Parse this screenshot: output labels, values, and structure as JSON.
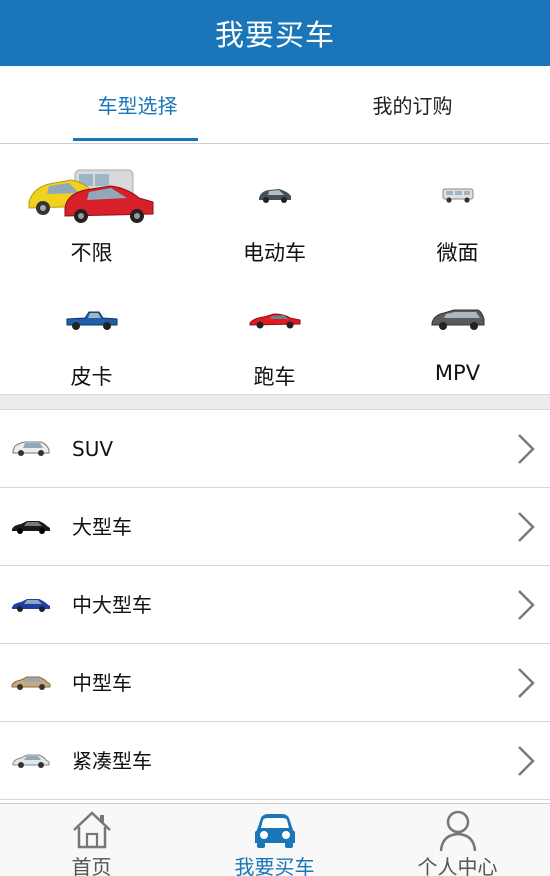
{
  "header": {
    "title": "我要买车"
  },
  "tabs": [
    {
      "label": "车型选择",
      "active": true
    },
    {
      "label": "我的订购",
      "active": false
    }
  ],
  "categories": [
    {
      "label": "不限",
      "icon": "car-group-icon"
    },
    {
      "label": "电动车",
      "icon": "electric-car-icon"
    },
    {
      "label": "微面",
      "icon": "minivan-icon"
    },
    {
      "label": "皮卡",
      "icon": "pickup-icon"
    },
    {
      "label": "跑车",
      "icon": "sports-car-icon"
    },
    {
      "label": "MPV",
      "icon": "mpv-icon"
    }
  ],
  "list": [
    {
      "label": "SUV",
      "icon": "suv-icon",
      "color": "#e8e8e8"
    },
    {
      "label": "大型车",
      "icon": "large-car-icon",
      "color": "#1a1a1a"
    },
    {
      "label": "中大型车",
      "icon": "mid-large-car-icon",
      "color": "#1f3fa8"
    },
    {
      "label": "中型车",
      "icon": "mid-car-icon",
      "color": "#c9a77a"
    },
    {
      "label": "紧凑型车",
      "icon": "compact-car-icon",
      "color": "#e6e6e6"
    }
  ],
  "bottom_nav": [
    {
      "label": "首页",
      "icon": "home-icon",
      "active": false
    },
    {
      "label": "我要买车",
      "icon": "car-front-icon",
      "active": true
    },
    {
      "label": "个人中心",
      "icon": "person-icon",
      "active": false
    }
  ],
  "colors": {
    "accent": "#1a76b9"
  }
}
